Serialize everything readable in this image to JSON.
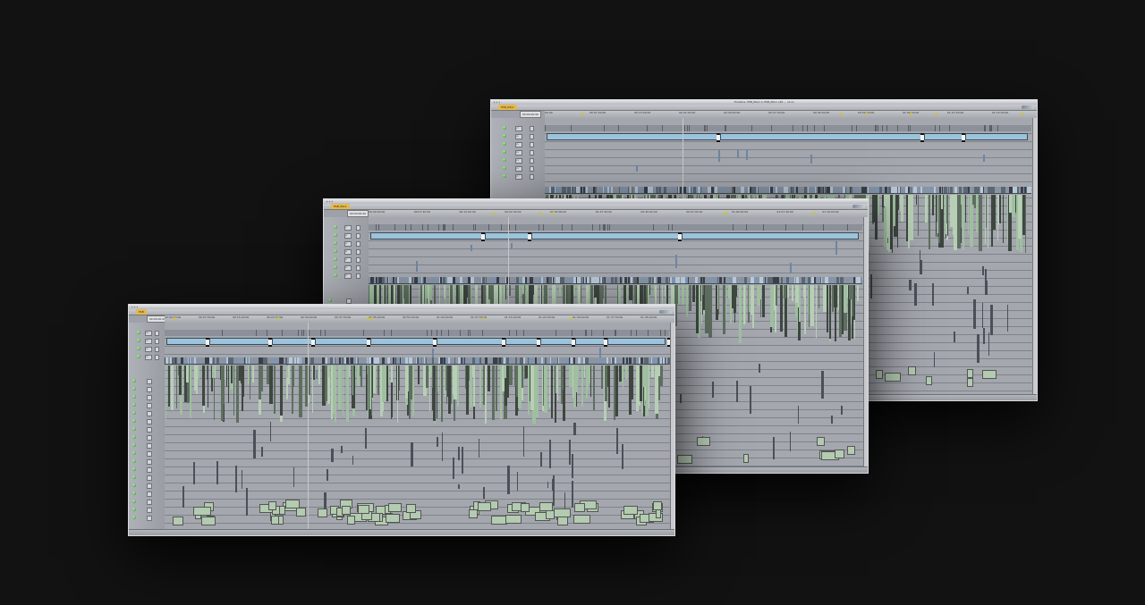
{
  "windows": [
    {
      "id": "back",
      "title": "Timeline: PSB_PAL1 in PSB_PAL1.v16 ... vt-xx",
      "tab": "PSB_PAL1",
      "timecode": "00:00:00:00",
      "ruler_ticks": [
        "00:00",
        "00:07:30:00",
        "00:15:00:00",
        "00:22:30:00",
        "00:30:00:00",
        "00:37:30:00",
        "00:45:00:00",
        "00:52:30:00",
        "01:00:00:00",
        "01:07:30:00",
        "01:15:00:00"
      ],
      "video_tracks": [
        "V7",
        "V6",
        "V5",
        "V4",
        "V3",
        "V2",
        "V1"
      ]
    },
    {
      "id": "middle",
      "title": "",
      "tab": "PSB_PAL1",
      "timecode": "00:00:00:00",
      "ruler_ticks": [
        "00:00:00:00",
        "00:07:30:00",
        "00:15:00:00",
        "00:22:30:00",
        "00:30:00:00",
        "00:37:30:00",
        "00:45:00:00",
        "00:52:30:00",
        "01:00:00:00",
        "01:07:30:00",
        "01:15:00:00"
      ],
      "video_tracks": [
        "V7",
        "V6",
        "V5",
        "V4",
        "V3",
        "V2",
        "V1"
      ]
    },
    {
      "id": "front",
      "title": "",
      "tab": "PSB",
      "timecode": "00:00:00:00",
      "ruler_ticks": [
        "00:00:00:00",
        "00:07:30:00",
        "00:15:00:00",
        "00:22:30:00",
        "00:30:00:00",
        "00:37:30:00",
        "00:45:00:00",
        "00:52:30:00",
        "01:00:00:00",
        "01:07:30:00",
        "01:15:00:00",
        "01:22:30:00",
        "01:30:00:00",
        "01:37:30:00",
        "01:45:00:00"
      ],
      "video_tracks": [
        "V4",
        "V3",
        "V2",
        "V1"
      ]
    }
  ],
  "colors": {
    "background": "#121212",
    "track": "#a4a7ae",
    "video_clip": "#9cc3dc",
    "audio_clip": "#a9c3a3",
    "audio_clip_dark": "#5f6e62",
    "marker": "#d0c03a"
  }
}
